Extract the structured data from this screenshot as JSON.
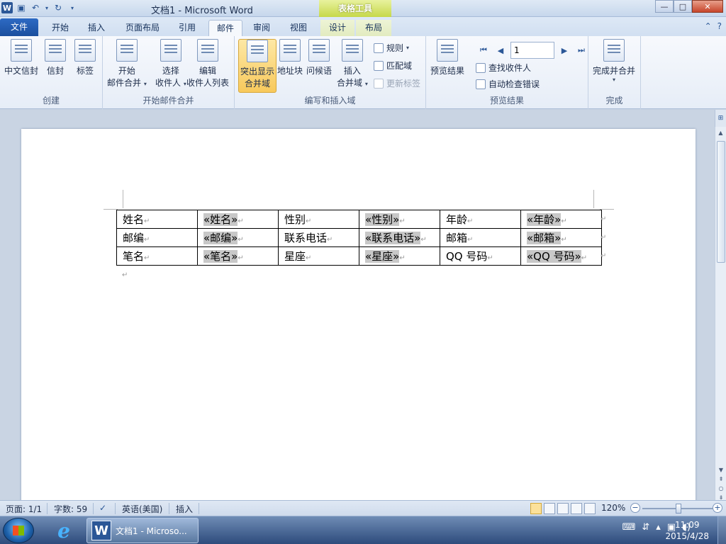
{
  "window": {
    "title": "文档1 - Microsoft Word",
    "context_tab_group": "表格工具",
    "controls": {
      "minimize": "—",
      "maximize": "□",
      "close": "✕"
    }
  },
  "quick_access": {
    "app_icon": "W"
  },
  "tabs": [
    {
      "label": "文件",
      "kind": "file"
    },
    {
      "label": "开始"
    },
    {
      "label": "插入"
    },
    {
      "label": "页面布局"
    },
    {
      "label": "引用"
    },
    {
      "label": "邮件",
      "active": true
    },
    {
      "label": "审阅"
    },
    {
      "label": "视图"
    },
    {
      "label": "设计",
      "context": true
    },
    {
      "label": "布局",
      "context": true
    }
  ],
  "ribbon": {
    "create": {
      "label": "创建",
      "chinese_envelope": "中文信封",
      "envelopes": "信封",
      "labels": "标签"
    },
    "start_merge": {
      "label": "开始邮件合并",
      "start_line1": "开始",
      "start_line2": "邮件合并",
      "select_line1": "选择",
      "select_line2": "收件人",
      "edit_line1": "编辑",
      "edit_line2": "收件人列表"
    },
    "write_insert": {
      "label": "编写和插入域",
      "highlight_line1": "突出显示",
      "highlight_line2": "合并域",
      "address_block": "地址块",
      "greeting": "问候语",
      "insert_line1": "插入",
      "insert_line2": "合并域",
      "rules": "规则",
      "match_fields": "匹配域",
      "update_labels": "更新标签"
    },
    "preview": {
      "label": "预览结果",
      "preview_results": "预览结果",
      "record_value": "1",
      "find_recipient": "查找收件人",
      "auto_check": "自动检查错误"
    },
    "finish": {
      "label": "完成",
      "finish_merge": "完成并合并"
    }
  },
  "table": {
    "rows": [
      {
        "c1": "姓名",
        "c2": "«姓名»",
        "c3": "性别",
        "c4": "«性别»",
        "c5": "年龄",
        "c6": "«年龄»"
      },
      {
        "c1": "邮编",
        "c2": "«邮编»",
        "c3": "联系电话",
        "c4": "«联系电话»",
        "c5": "邮箱",
        "c6": "«邮箱»"
      },
      {
        "c1": "笔名",
        "c2": "«笔名»",
        "c3": "星座",
        "c4": "«星座»",
        "c5": "QQ 号码",
        "c6": "«QQ 号码»"
      }
    ],
    "paragraph_mark": "↵"
  },
  "status": {
    "page": "页面: 1/1",
    "words": "字数: 59",
    "language": "英语(美国)",
    "mode": "插入",
    "zoom": "120%"
  },
  "taskbar": {
    "word_button": "文档1 - Microso...",
    "time": "11:09",
    "date": "2015/4/28"
  }
}
